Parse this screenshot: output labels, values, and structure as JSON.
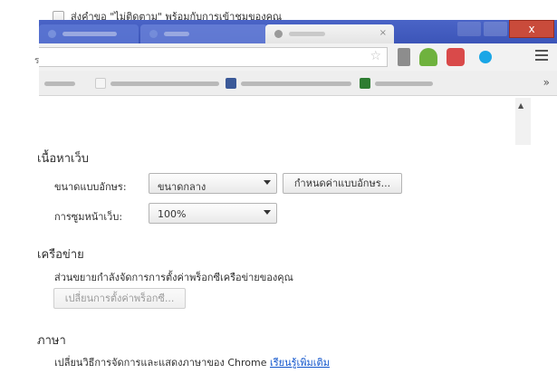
{
  "privacy": {
    "do_not_track_label": "ส่งคำขอ \"ไม่ติดตาม\" พร้อมกับการเข้าชมของคุณ"
  },
  "browser_overlay": {
    "close_glyph": "x",
    "tab_close_glyph": "×",
    "star_glyph": "☆",
    "overflow_glyph": "»",
    "cut_off_char": "ร",
    "icons": [
      "star-icon",
      "extension-icon",
      "android-icon",
      "pocket-icon",
      "skype-icon",
      "menu-icon"
    ]
  },
  "scrollbar": {
    "up_glyph": "▲"
  },
  "web_content": {
    "title": "เนื้อหาเว็บ",
    "font_size_label": "ขนาดแบบอักษร:",
    "font_size_value": "ขนาดกลาง",
    "customize_fonts_button": "กำหนดค่าแบบอักษร...",
    "page_zoom_label": "การซูมหน้าเว็บ:",
    "page_zoom_value": "100%"
  },
  "network": {
    "title": "เครือข่าย",
    "description": "ส่วนขยายกำลังจัดการการตั้งค่าพร็อกซีเครือข่ายของคุณ",
    "change_proxy_button": "เปลี่ยนการตั้งค่าพร็อกซี..."
  },
  "languages": {
    "title": "ภาษา",
    "description": "เปลี่ยนวิธีการจัดการและแสดงภาษาของ Chrome",
    "learn_more_link": "เรียนรู้เพิ่มเติม"
  },
  "colors": {
    "tabstrip": "#3c55b8",
    "close_button": "#c94b3b",
    "link": "#1155cc"
  }
}
